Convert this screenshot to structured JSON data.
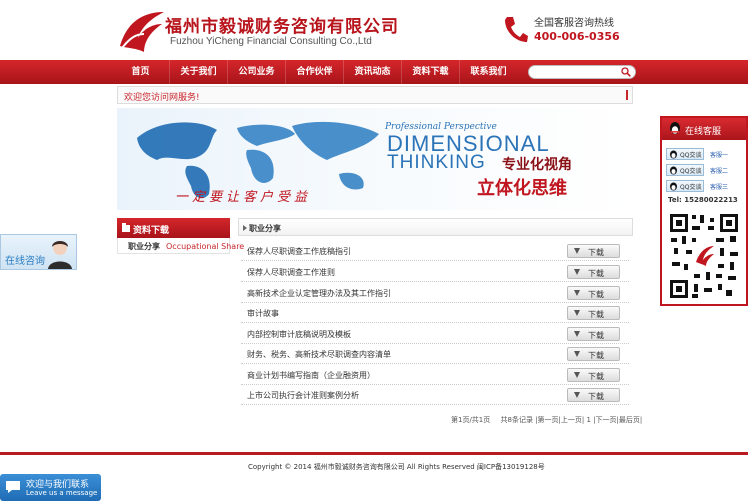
{
  "header": {
    "company_cn": "福州市毅诚财务咨询有限公司",
    "company_en": "Fuzhou YiCheng Financial Consulting Co.,Ltd",
    "hotline_label": "全国客服咨询热线",
    "hotline_number": "400-006-0356"
  },
  "nav": {
    "items": [
      "首页",
      "关于我们",
      "公司业务",
      "合作伙伴",
      "资讯动态",
      "资料下载",
      "联系我们"
    ]
  },
  "search": {
    "value": ""
  },
  "welcome": "欢迎您访问网服务!",
  "banner": {
    "perspective": "Professional Perspective",
    "dimensional": "DIMENSIONAL",
    "thinking": "THINKING",
    "cn_line1": "专业化视角",
    "cn_line2": "立体化思维",
    "slogan": "一定要让客户受益"
  },
  "sidebar": {
    "title": "资料下载",
    "item_cn": "职业分享",
    "item_en": "Occupational Share"
  },
  "content": {
    "section_title": "职业分享",
    "download_label": "下载",
    "documents": [
      "保荐人尽职调查工作底稿指引",
      "保荐人尽职调查工作准则",
      "高新技术企业认定管理办法及其工作指引",
      "审计故事",
      "内部控制审计底稿说明及模板",
      "财务、税务、高新技术尽职调查内容清单",
      "商业计划书编写指南（企业融资用）",
      "上市公司执行会计准则案例分析"
    ],
    "pager": {
      "page_info": "第1页/共1页",
      "record_info": "共8条记录 |第一页|上一页| 1 |下一页|最后页|"
    }
  },
  "footer": {
    "copyright": "Copyright © 2014 福州市毅诚财务咨询有限公司 All Rights Reserved 闽ICP备13019128号"
  },
  "float_left": {
    "label": "在线咨询"
  },
  "float_right": {
    "title": "在线客服",
    "qq_label": "QQ交谈",
    "contacts": [
      "客服一",
      "客服二",
      "客服三"
    ],
    "tel": "Tel: 15280022213"
  },
  "float_bottom": {
    "line1": "欢迎与我们联系",
    "line2": "Leave us a message"
  },
  "colors": {
    "brand_red": "#c0161f",
    "accent_blue": "#2c74b8"
  }
}
